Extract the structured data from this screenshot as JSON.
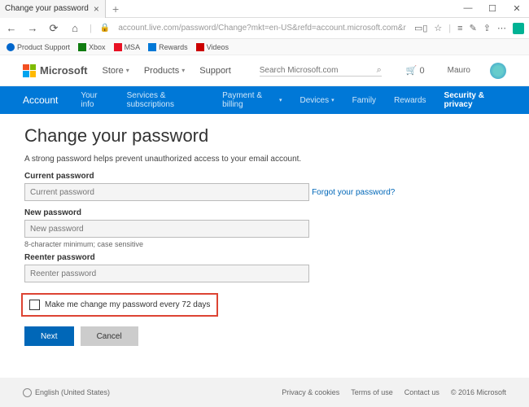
{
  "browser": {
    "tab_title": "Change your password",
    "url": "account.live.com/password/Change?mkt=en-US&refd=account.microsoft.com&refp=privacy"
  },
  "favorites": [
    "Product Support",
    "Xbox",
    "MSA",
    "Rewards",
    "Videos"
  ],
  "header": {
    "brand": "Microsoft",
    "menu": [
      "Store",
      "Products",
      "Support"
    ],
    "search_placeholder": "Search Microsoft.com",
    "cart_count": "0",
    "user_name": "Mauro"
  },
  "nav": {
    "account": "Account",
    "items": [
      "Your info",
      "Services & subscriptions",
      "Payment & billing",
      "Devices",
      "Family",
      "Rewards",
      "Security & privacy"
    ]
  },
  "page": {
    "title": "Change your password",
    "subtitle": "A strong password helps prevent unauthorized access to your email account.",
    "current_label": "Current password",
    "current_ph": "Current password",
    "forgot": "Forgot your password?",
    "new_label": "New password",
    "new_ph": "New password",
    "hint": "8-character minimum; case sensitive",
    "reenter_label": "Reenter password",
    "reenter_ph": "Reenter password",
    "checkbox_label": "Make me change my password every 72 days",
    "next": "Next",
    "cancel": "Cancel"
  },
  "footer": {
    "lang": "English (United States)",
    "links": [
      "Privacy & cookies",
      "Terms of use",
      "Contact us"
    ],
    "copyright": "© 2016 Microsoft"
  }
}
